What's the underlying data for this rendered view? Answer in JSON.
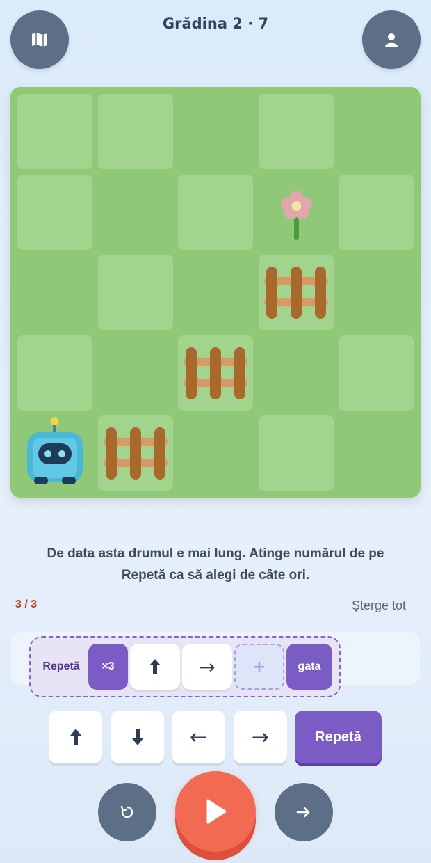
{
  "header": {
    "title": "Grădina 2 · 7",
    "map_icon": "map-icon",
    "profile_icon": "user-icon"
  },
  "board": {
    "rows": 5,
    "cols": 5,
    "colors": {
      "grass": "#8fc977",
      "tile_light": "#a3d48d",
      "fence": "#a9692d",
      "robot": "#4cb8d8"
    },
    "light_tiles": [
      [
        0,
        0
      ],
      [
        0,
        1
      ],
      [
        0,
        3
      ],
      [
        1,
        0
      ],
      [
        1,
        2
      ],
      [
        1,
        4
      ],
      [
        2,
        1
      ],
      [
        2,
        3
      ],
      [
        3,
        0
      ],
      [
        3,
        2
      ],
      [
        3,
        4
      ],
      [
        4,
        1
      ],
      [
        4,
        3
      ]
    ],
    "flower": [
      1,
      3
    ],
    "fences": [
      [
        2,
        3
      ],
      [
        3,
        2
      ],
      [
        4,
        1
      ]
    ],
    "robot": [
      4,
      0
    ]
  },
  "instruction": "De data asta drumul e mai lung. Atinge numărul de pe Repetă ca să alegi de câte ori.",
  "program": {
    "count": "3 / 3",
    "clear_label": "Șterge tot",
    "repeat_label": "Repetă",
    "times_label": "×3",
    "right_arrow": "→",
    "add_label": "+",
    "done_label": "gata"
  },
  "palette": {
    "left_arrow": "←",
    "right_arrow": "→",
    "repeat_label": "Repetă"
  },
  "controls": {
    "reset_icon": "reset-icon",
    "play_icon": "play-icon",
    "step_icon": "step-arrow-icon",
    "play_color": "#f26a52"
  }
}
